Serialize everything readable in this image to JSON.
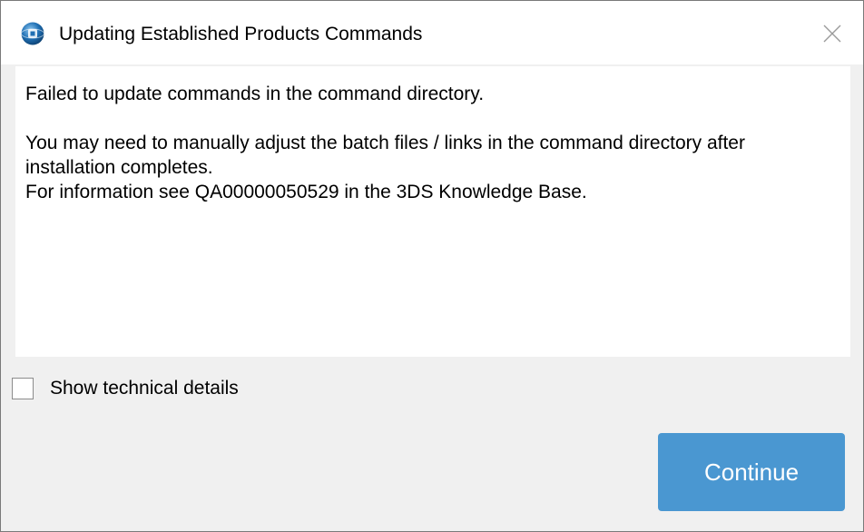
{
  "window": {
    "title": "Updating Established Products Commands",
    "app_icon": "3ds-globe-icon",
    "close_icon": "close-icon"
  },
  "message": {
    "line1": "Failed to update commands in the command directory.",
    "line2": "You may need to manually adjust the batch files / links in the command directory after installation completes.",
    "line3": "For information see QA00000050529 in the 3DS Knowledge Base."
  },
  "details": {
    "label": "Show technical details",
    "checked": false
  },
  "actions": {
    "continue_label": "Continue"
  },
  "colors": {
    "accent": "#4a97d1",
    "window_bg": "#f0f0f0",
    "panel_bg": "#ffffff"
  }
}
